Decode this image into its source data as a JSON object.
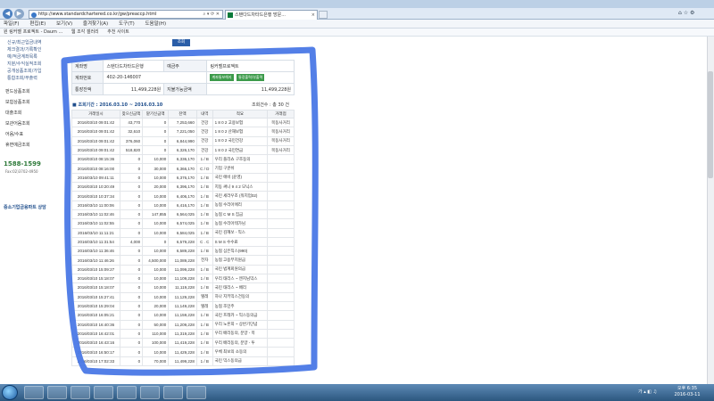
{
  "browser": {
    "url": "http://www.standardchartered.co.kr/gw/preaccp.html",
    "tab_title": "스탠다드차타드은행 방문...",
    "menu": [
      "파일(F)",
      "편집(E)",
      "보기(V)",
      "즐겨찾기(A)",
      "도구(T)",
      "도움말(H)"
    ],
    "favorites": [
      "원 링커벨 프로젝트 - Daum ...",
      "웹 조각 갤러리",
      "추천 사이트"
    ]
  },
  "sidebar": {
    "items_top": [
      "신규/최근입금내역",
      "체크결과/기록확인",
      "예/적금계좌목록",
      "지분/수익실적조회",
      "공개상품조회/가입",
      "통합조회/부출력"
    ],
    "items": [
      "펀드상품조회",
      "보험상품조회",
      "대출조회",
      "보관어음조회",
      "어음/수표",
      "휴면예금조회"
    ],
    "phone": "1588-1599",
    "phone_sub": "Fax:02)3702-4950",
    "bottom": "중소기업금융파트 상담"
  },
  "confirm_button": "조회",
  "account": {
    "label_bank": "계좌명",
    "bank": "스탠다드차타드은행",
    "label_kind": "예금주",
    "kind": "링커벨프로젝트",
    "label_no": "계좌번호",
    "number": "402-20-146007",
    "btn1": "계좌통보해지",
    "btn2": "통장출력/부출력",
    "label_bal": "통장잔액",
    "balance": "11,499,228원",
    "label_avail": "지불가능금액",
    "available": "11,499,228원"
  },
  "period": "■ 조회기간 : 2016.03.10 ~ 2016.03.10",
  "count": "조회건수 : 총 30 건",
  "columns": [
    "거래일시",
    "찾으신금액",
    "맡기신금액",
    "잔액",
    "내역",
    "적요",
    "거래점"
  ],
  "rows": [
    [
      "2016/03/10 09:01:42",
      "43,770",
      "0",
      "7,253,660",
      "건강",
      "1 8 0 2 고용보험",
      "목동사거리"
    ],
    [
      "2016/03/10 09:01:42",
      "32,610",
      "0",
      "7,221,050",
      "건강",
      "1 8 0 2 산재보험",
      "목동사거리"
    ],
    [
      "2016/03/10 09:01:42",
      "376,060",
      "0",
      "6,844,990",
      "건강",
      "1 8 0 2 국민건강",
      "목동사거리"
    ],
    [
      "2016/03/10 09:01:42",
      "518,820",
      "0",
      "6,326,170",
      "건강",
      "1 8 0 2 국민연금",
      "목동사거리"
    ],
    [
      "2016/03/10 08:15:36",
      "0",
      "10,000",
      "6,336,170",
      "1 / B",
      "우리   플리쇼   구조동의",
      ""
    ],
    [
      "2016/03/10 08:16:00",
      "0",
      "30,000",
      "6,366,170",
      "C / D",
      "기업   구쿤쉬",
      ""
    ],
    [
      "2016/03/10 09:41:11",
      "0",
      "10,000",
      "6,376,170",
      "1 / B",
      "국민   애비 (윤영)",
      ""
    ],
    [
      "2016/03/10 10:20:49",
      "0",
      "20,000",
      "6,396,170",
      "1 / B",
      "지동   써니 9 4 2 모닉스",
      ""
    ],
    [
      "2016/03/10 10:37:34",
      "0",
      "10,000",
      "6,406,170",
      "1 / B",
      "국민   세라우조 (워지업02)",
      ""
    ],
    [
      "2016/03/10 11:00:06",
      "0",
      "10,000",
      "6,416,170",
      "1 / B",
      "농협   수리아에리",
      ""
    ],
    [
      "2016/03/10 11:02:46",
      "0",
      "147,855",
      "6,564,025",
      "1 / B",
      "농협   C M S 집금",
      ""
    ],
    [
      "2016/03/10 11:02:55",
      "0",
      "10,000",
      "6,574,025",
      "1 / B",
      "농협   수리아테가님",
      ""
    ],
    [
      "2016/03/10 11:11:21",
      "0",
      "10,000",
      "6,584,025",
      "1 / B",
      "국민   김혜쏘 - 믹스",
      ""
    ],
    [
      "2016/03/10 11:31:54",
      "4,000",
      "0",
      "6,579,228",
      "C . C",
      "S M S 수수료",
      ""
    ],
    [
      "2016/03/10 11:36:46",
      "0",
      "10,000",
      "6,589,228",
      "1 / B",
      "농협   심은직스(990)",
      ""
    ],
    [
      "2016/03/10 11:46:26",
      "0",
      "4,500,000",
      "11,089,228",
      "전자",
      "농협   고용부지원금",
      ""
    ],
    [
      "2016/03/10 15:09:27",
      "0",
      "10,000",
      "11,099,228",
      "1 / B",
      "국민   법계회원의금",
      ""
    ],
    [
      "2016/03/10 15:18:07",
      "0",
      "10,000",
      "11,109,228",
      "1 / B",
      "우리   태리스 ~ 엔지님믹스",
      ""
    ],
    [
      "2016/03/10 15:18:07",
      "0",
      "10,000",
      "11,119,228",
      "1 / B",
      "국민   태리스 ~ 배리",
      ""
    ],
    [
      "2016/03/10 15:27:41",
      "0",
      "10,000",
      "11,129,228",
      "텔레",
      "하나   지키믹스건동의",
      ""
    ],
    [
      "2016/03/10 15:29:04",
      "0",
      "20,000",
      "11,149,228",
      "텔레",
      "농협   조민주",
      ""
    ],
    [
      "2016/03/10 16:05:21",
      "0",
      "10,000",
      "11,159,228",
      "1 / B",
      "국민   프레카 ~ 믹스동의금",
      ""
    ],
    [
      "2016/03/10 16:40:36",
      "0",
      "50,000",
      "11,209,228",
      "1 / B",
      "우리   노흔희 ~ 상반기단념",
      ""
    ],
    [
      "2016/03/10 16:42:01",
      "0",
      "110,000",
      "11,319,228",
      "1 / B",
      "우리   배리동의, 분양 - 목",
      ""
    ],
    [
      "2016/03/10 16:43:16",
      "0",
      "100,000",
      "11,419,228",
      "1 / B",
      "우리   배리동의, 분양 - 투",
      ""
    ],
    [
      "2016/03/10 16:50:17",
      "0",
      "10,000",
      "11,429,228",
      "1 / B",
      "우체   최보의 소동의",
      ""
    ],
    [
      "2016/03/10 17:02:33",
      "0",
      "70,000",
      "11,499,228",
      "1 / B",
      "국민   믹스동의금",
      ""
    ]
  ],
  "taskbar": {
    "time": "오후 6:35",
    "date": "2016-03-11",
    "lang": "가"
  }
}
